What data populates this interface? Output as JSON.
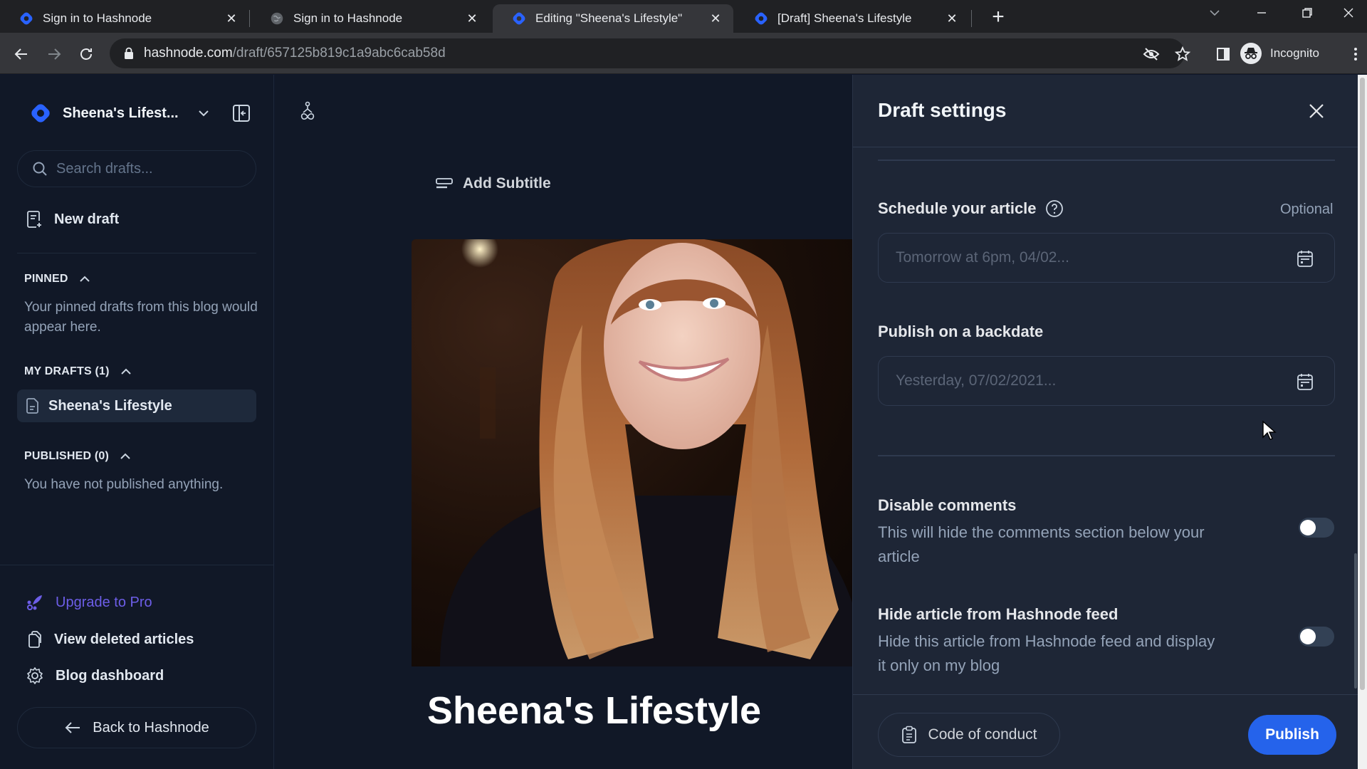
{
  "browser": {
    "tabs": [
      {
        "title": "Sign in to Hashnode",
        "icon": "hashnode-favicon",
        "active": false
      },
      {
        "title": "Sign in to Hashnode",
        "icon": "globe-favicon",
        "active": false
      },
      {
        "title": "Editing \"Sheena's Lifestyle\"",
        "icon": "hashnode-favicon",
        "active": true
      },
      {
        "title": "[Draft] Sheena's Lifestyle",
        "icon": "hashnode-favicon",
        "active": false
      }
    ],
    "close_glyph": "✕",
    "new_tab_glyph": "+",
    "url_host": "hashnode.com",
    "url_path": "/draft/657125b819c1a9abc6cab58d",
    "profile_label": "Incognito"
  },
  "sidebar": {
    "blog_name": "Sheena's Lifest...",
    "search_placeholder": "Search drafts...",
    "new_draft_label": "New draft",
    "pinned": {
      "heading": "PINNED",
      "empty_text": "Your pinned drafts from this blog would appear here."
    },
    "my_drafts": {
      "heading": "MY DRAFTS (1)",
      "items": [
        {
          "title": "Sheena's Lifestyle"
        }
      ]
    },
    "published": {
      "heading": "PUBLISHED (0)",
      "empty_text": "You have not published anything."
    },
    "links": [
      {
        "label": "Upgrade to Pro",
        "icon": "rocket-icon"
      },
      {
        "label": "View deleted articles",
        "icon": "deleted-articles-icon"
      },
      {
        "label": "Blog dashboard",
        "icon": "gear-icon"
      }
    ],
    "back_label": "Back to Hashnode"
  },
  "editor": {
    "add_subtitle_label": "Add Subtitle",
    "article_title": "Sheena's Lifestyle",
    "cover_image_alt": "Portrait of a smiling woman with long auburn hair"
  },
  "draft_settings": {
    "title": "Draft settings",
    "schedule": {
      "label": "Schedule your article",
      "optional_label": "Optional",
      "placeholder": "Tomorrow at 6pm, 04/02..."
    },
    "backdate": {
      "label": "Publish on a backdate",
      "placeholder": "Yesterday, 07/02/2021..."
    },
    "disable_comments": {
      "title": "Disable comments",
      "description": "This will hide the comments section below your article",
      "enabled": false
    },
    "hide_from_feed": {
      "title": "Hide article from Hashnode feed",
      "description": "Hide this article from Hashnode feed and display it only on my blog",
      "enabled": false
    },
    "code_of_conduct_label": "Code of conduct",
    "publish_label": "Publish"
  },
  "colors": {
    "brand_blue": "#2962ff",
    "publish_blue": "#2563eb",
    "pro_purple": "#6d5ee8"
  }
}
